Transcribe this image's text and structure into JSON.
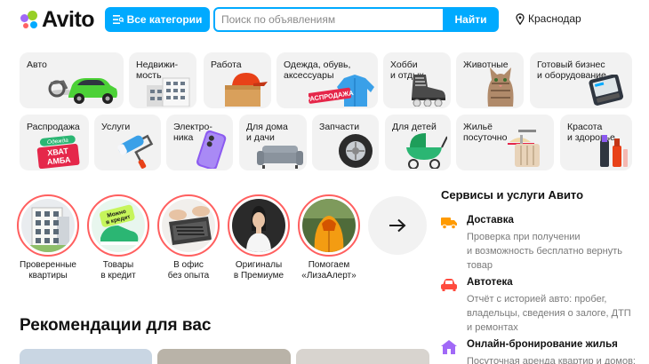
{
  "header": {
    "logo_text": "Avito",
    "categories_button": "Все категории",
    "search_placeholder": "Поиск по объявлениям",
    "search_button": "Найти",
    "location": "Краснодар"
  },
  "categories": [
    {
      "label": "Авто",
      "icon": "car-icon"
    },
    {
      "label": "Недвижи-\nмость",
      "icon": "building-icon"
    },
    {
      "label": "Работа",
      "icon": "cap-box-icon"
    },
    {
      "label": "Одежда, обувь,\nаксессуары",
      "icon": "jacket-icon",
      "badge": "РАСПРОДАЖА"
    },
    {
      "label": "Хобби\nи отдых",
      "icon": "roller-skate-icon"
    },
    {
      "label": "Животные",
      "icon": "cat-icon"
    },
    {
      "label": "Готовый бизнес\nи оборудование",
      "icon": "terminal-icon"
    },
    {
      "label": "Распродажа",
      "icon": "sale-tag-icon",
      "badge_top": "Одежда",
      "badge_main": "ХВАТ\nАМБА"
    },
    {
      "label": "Услуги",
      "icon": "paint-roller-icon"
    },
    {
      "label": "Электро-\nника",
      "icon": "phone-icon"
    },
    {
      "label": "Для дома\nи дачи",
      "icon": "sofa-icon"
    },
    {
      "label": "Запчасти",
      "icon": "tire-icon"
    },
    {
      "label": "Для детей",
      "icon": "stroller-icon"
    },
    {
      "label": "Жильё\nпосуточно",
      "icon": "suitcase-icon"
    },
    {
      "label": "Красота\nи здоровье",
      "icon": "cosmetics-icon"
    }
  ],
  "stories": [
    {
      "label": "Проверенные\nквартиры",
      "image": "apartment-building-photo"
    },
    {
      "label": "Товары\nв кредит",
      "image": "sneakers-photo",
      "sticker": "Можно\nв кредит"
    },
    {
      "label": "В офис\nбез опыта",
      "image": "laptop-photo"
    },
    {
      "label": "Оригиналы\nв Премиуме",
      "image": "woman-photo"
    },
    {
      "label": "Помогаем\n«ЛизаАлерт»",
      "image": "volunteer-photo"
    }
  ],
  "services": {
    "title": "Сервисы и услуги Авито",
    "items": [
      {
        "name": "Доставка",
        "icon": "truck-icon",
        "color": "#ff9a00",
        "desc": "Проверка при получении\nи возможность бесплатно вернуть\nтовар"
      },
      {
        "name": "Автотека",
        "icon": "car-icon",
        "color": "#ff4b3e",
        "desc": "Отчёт с историей авто: пробег,\nвладельцы, сведения о залоге, ДТП\nи ремонтах"
      },
      {
        "name": "Онлайн-бронирование жилья",
        "icon": "house-icon",
        "color": "#a169f7",
        "desc": "Посуточная аренда квартир и домов:"
      }
    ]
  },
  "recommendations": {
    "title": "Рекомендации для вас"
  },
  "colors": {
    "accent": "#00aaff",
    "story_ring": "#ff5f5f",
    "tile_bg": "#f2f2f2"
  }
}
